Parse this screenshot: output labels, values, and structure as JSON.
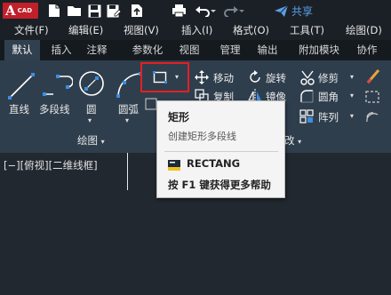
{
  "app": {
    "logo_letter": "A",
    "logo_text": "CAD"
  },
  "quick_access": {
    "icons": [
      "new-file-icon",
      "open-folder-icon",
      "save-icon",
      "save-as-icon",
      "upload-icon",
      "print-icon",
      "undo-icon",
      "redo-icon"
    ],
    "share_label": "共享"
  },
  "menu": {
    "items": [
      "文件(F)",
      "编辑(E)",
      "视图(V)",
      "插入(I)",
      "格式(O)",
      "工具(T)",
      "绘图(D)"
    ]
  },
  "tabs": {
    "items": [
      "默认",
      "插入",
      "注释",
      "参数化",
      "视图",
      "管理",
      "输出",
      "附加模块",
      "协作"
    ],
    "active": "默认"
  },
  "ribbon": {
    "draw_tools": [
      "直线",
      "多段线",
      "圆",
      "圆弧"
    ],
    "modify_tools": [
      "移动",
      "旋转",
      "修剪",
      "复制",
      "镜像",
      "圆角",
      "阵列"
    ],
    "draw_panel_title": "绘图",
    "modify_panel_title": "修改",
    "modify_panel_title_visible": "改"
  },
  "viewport": {
    "label": "[−][俯视][二维线框]"
  },
  "tooltip": {
    "title": "矩形",
    "description": "创建矩形多段线",
    "command": "RECTANG",
    "help": "按 F1 键获得更多帮助"
  },
  "colors": {
    "highlight": "#e42020",
    "share": "#5aa0e8",
    "ribbon_bg": "#2f3e4d",
    "logo": "#c0202a"
  }
}
